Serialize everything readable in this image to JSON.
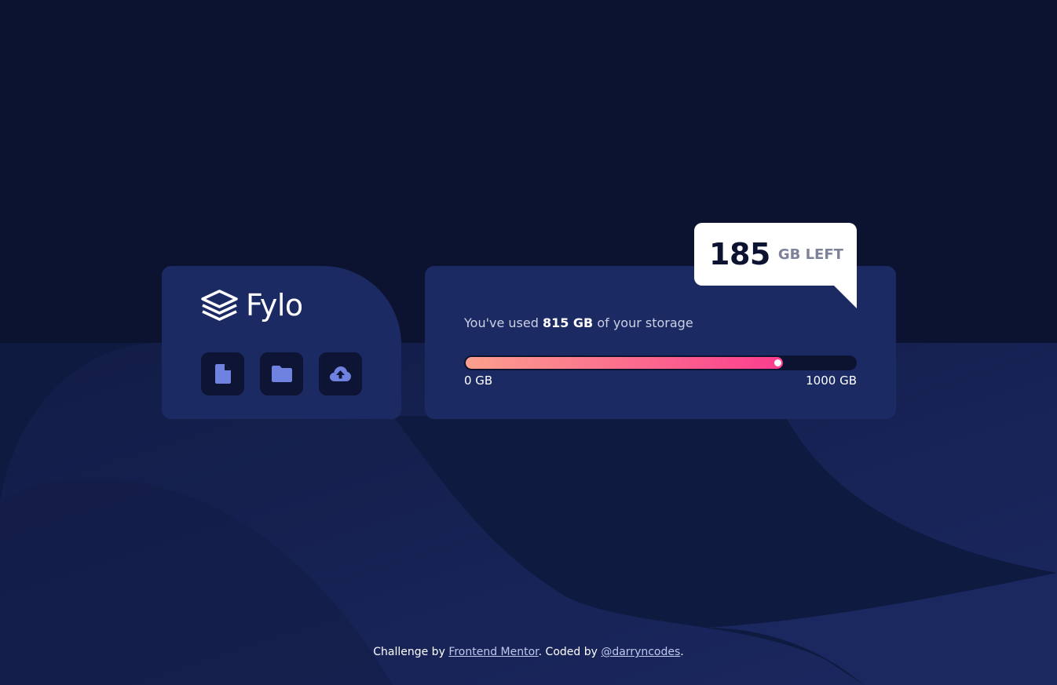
{
  "brand": {
    "name": "Fylo",
    "logo_icon": "layers-icon"
  },
  "actions": [
    {
      "icon": "document-icon",
      "name": "document-button"
    },
    {
      "icon": "folder-icon",
      "name": "folder-button"
    },
    {
      "icon": "upload-icon",
      "name": "upload-button"
    }
  ],
  "storage": {
    "usage_prefix": "You've used ",
    "used_amount": "815 GB",
    "usage_suffix": " of your storage",
    "used_gb": 815,
    "total_gb": 1000,
    "min_label": "0 GB",
    "max_label": "1000 GB",
    "remaining_value": "185",
    "remaining_unit": "GB LEFT"
  },
  "footer": {
    "prefix": "Challenge by ",
    "link1": "Frontend Mentor",
    "middle": ". Coded by ",
    "link2": "@darryncodes",
    "suffix": "."
  },
  "colors": {
    "background": "#0c1330",
    "card": "#1c2a63",
    "gradient_start": "#fca08d",
    "gradient_end": "#fb3d8e",
    "icon": "#6f82e0"
  }
}
